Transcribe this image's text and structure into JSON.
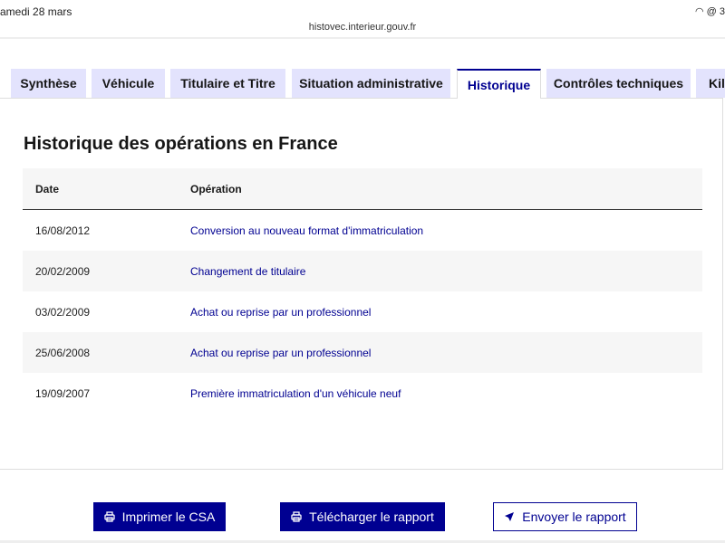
{
  "status": {
    "date": "amedi 28 mars",
    "right": "3"
  },
  "browser": {
    "url": "histovec.interieur.gouv.fr"
  },
  "tabs": [
    "Synthèse",
    "Véhicule",
    "Titulaire et Titre",
    "Situation administrative",
    "Historique",
    "Contrôles techniques",
    "Kilométrage"
  ],
  "active_tab": "Historique",
  "title": "Historique des opérations en France",
  "table": {
    "headers": [
      "Date",
      "Opération"
    ],
    "rows": [
      [
        "16/08/2012",
        "Conversion au nouveau format d'immatriculation"
      ],
      [
        "20/02/2009",
        "Changement de titulaire"
      ],
      [
        "03/02/2009",
        "Achat ou reprise par un professionnel"
      ],
      [
        "25/06/2008",
        "Achat ou reprise par un professionnel"
      ],
      [
        "19/09/2007",
        "Première immatriculation d'un véhicule neuf"
      ]
    ]
  },
  "buttons": {
    "print": "Imprimer le CSA",
    "download": "Télécharger le rapport",
    "send": "Envoyer le rapport"
  },
  "colors": {
    "primary": "#000091",
    "tab_bg": "#e3e3fd"
  }
}
